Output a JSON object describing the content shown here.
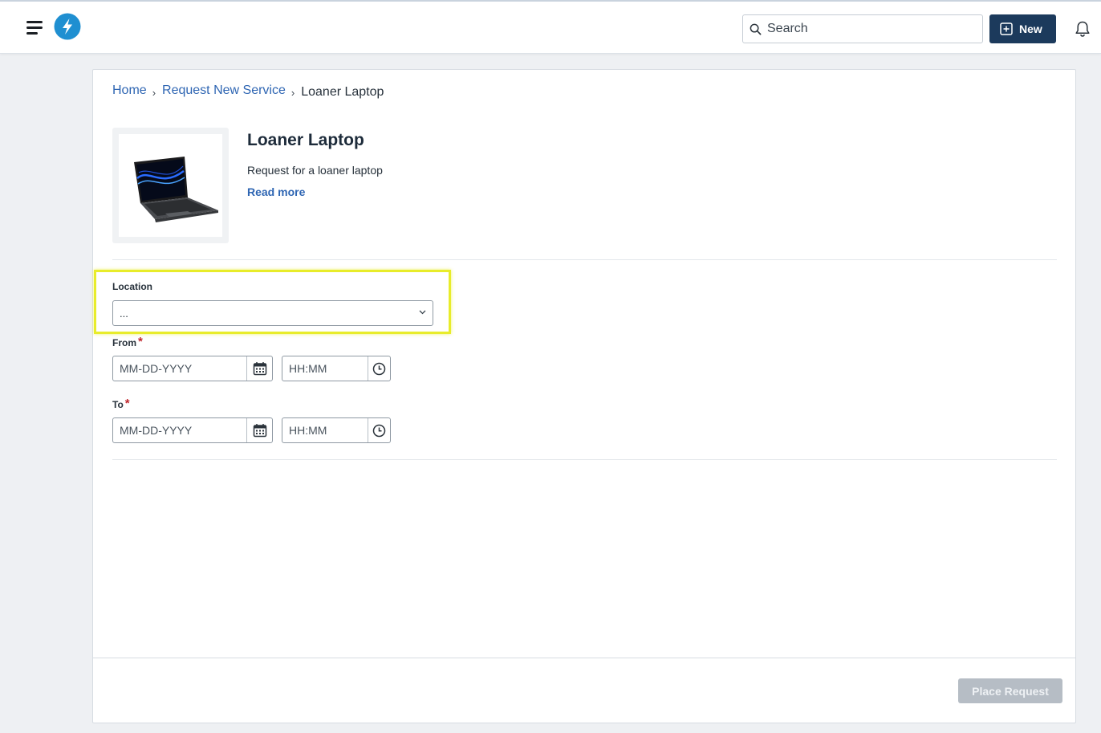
{
  "header": {
    "menu_icon": "hamburger-icon",
    "logo_icon": "lightning-bolt-icon",
    "search": {
      "placeholder": "Search",
      "value": ""
    },
    "new_button_label": "New",
    "notifications_icon": "bell-icon"
  },
  "breadcrumb": {
    "items": [
      "Home",
      "Request New Service"
    ],
    "current": "Loaner Laptop"
  },
  "item": {
    "title": "Loaner Laptop",
    "description": "Request for a loaner laptop",
    "read_more_label": "Read more",
    "image_icon": "laptop-image"
  },
  "form": {
    "location": {
      "label": "Location",
      "value": "..."
    },
    "from": {
      "label": "From",
      "required_mark": "*",
      "date_placeholder": "MM-DD-YYYY",
      "time_placeholder": "HH:MM"
    },
    "to": {
      "label": "To",
      "required_mark": "*",
      "date_placeholder": "MM-DD-YYYY",
      "time_placeholder": "HH:MM"
    }
  },
  "footer": {
    "place_request_label": "Place Request",
    "place_request_enabled": false
  },
  "colors": {
    "primary_dark": "#1c3a5c",
    "link_blue": "#2f66b3",
    "highlight_yellow": "#e8ec2a",
    "required_red": "#c0262d",
    "disabled_button": "#b6bdc5"
  }
}
